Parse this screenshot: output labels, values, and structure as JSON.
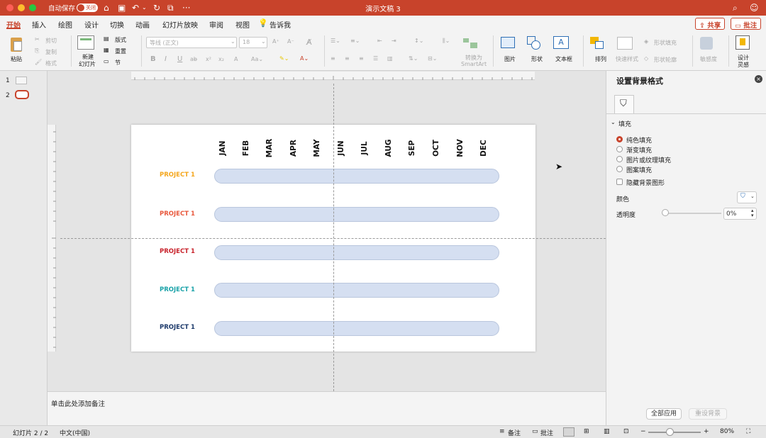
{
  "titlebar": {
    "autosave_label": "自动保存",
    "autosave_state": "关闭",
    "doc_title": "演示文稿 3"
  },
  "tabs": [
    "开始",
    "插入",
    "绘图",
    "设计",
    "切换",
    "动画",
    "幻灯片放映",
    "审阅",
    "视图"
  ],
  "tell_me": "告诉我",
  "share_label": "共享",
  "comment_label": "批注",
  "ribbon": {
    "paste": "粘贴",
    "cut": "剪切",
    "copy": "复制",
    "format": "格式",
    "new_slide_line1": "新建",
    "new_slide_line2": "幻灯片",
    "layout": "版式",
    "reset": "重置",
    "section": "节",
    "font_name": "等线 (正文)",
    "font_size": "18",
    "convert_line1": "转换为",
    "convert_line2": "SmartArt",
    "picture": "图片",
    "shape": "形状",
    "textbox": "文本框",
    "arrange": "排列",
    "quick_styles": "快速样式",
    "shape_fill": "形状填充",
    "shape_outline": "形状轮廓",
    "sensitivity": "敏感度",
    "designer_line1": "设计",
    "designer_line2": "灵感"
  },
  "slides": [
    "1",
    "2"
  ],
  "slide": {
    "months": [
      "JAN",
      "FEB",
      "MAR",
      "APR",
      "MAY",
      "JUN",
      "JUL",
      "AUG",
      "SEP",
      "OCT",
      "NOV",
      "DEC"
    ],
    "projects": [
      {
        "label": "PROJECT 1",
        "color": "#f4a61d"
      },
      {
        "label": "PROJECT 1",
        "color": "#e8583c"
      },
      {
        "label": "PROJECT 1",
        "color": "#c8232c"
      },
      {
        "label": "PROJECT 1",
        "color": "#19a2a8"
      },
      {
        "label": "PROJECT 1",
        "color": "#1d3a6b"
      }
    ],
    "bar_color": "#d5dff1"
  },
  "notes_placeholder": "单击此处添加备注",
  "format_panel": {
    "title": "设置背景格式",
    "section": "填充",
    "options": [
      "纯色填充",
      "渐变填充",
      "图片或纹理填充",
      "图案填充"
    ],
    "hide_bg": "隐藏背景图形",
    "color_label": "颜色",
    "transparency_label": "透明度",
    "transparency_value": "0%",
    "apply_all": "全部应用",
    "reset_bg": "重设背景"
  },
  "status": {
    "slide_info": "幻灯片 2 / 2",
    "language": "中文(中国)",
    "notes": "备注",
    "comments": "批注",
    "zoom": "80%"
  },
  "colors": {
    "accent": "#c8432b"
  }
}
